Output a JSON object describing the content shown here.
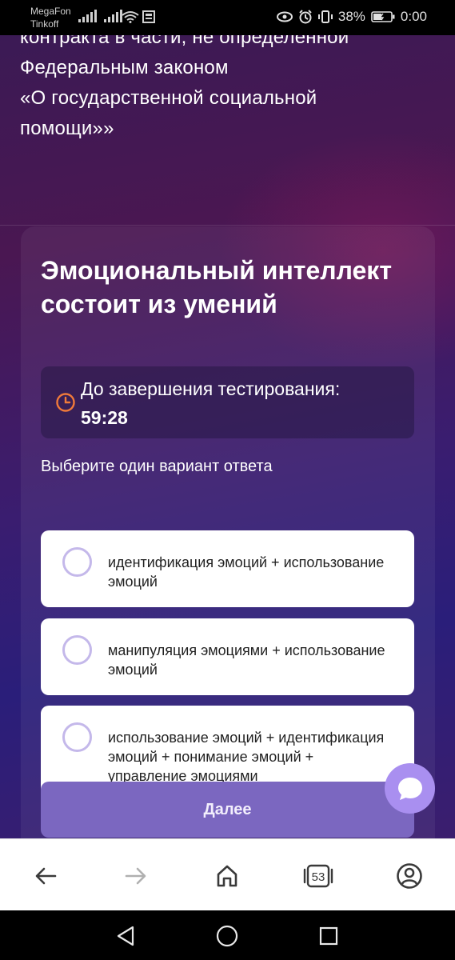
{
  "status_bar": {
    "carrier_1": "MegaFon",
    "carrier_2": "Tinkoff",
    "battery": "38%",
    "time": "0:00"
  },
  "page": {
    "top_text_lines": [
      "контракта в части, не определенной",
      "Федеральным законом",
      "«О государственной социальной",
      "помощи»»"
    ]
  },
  "question": {
    "title": "Эмоциональный интеллект состоит из умений",
    "timer_label": "До завершения тестирования:",
    "timer_value": "59:28",
    "instruction": "Выберите один вариант ответа",
    "options": [
      "идентификация эмоций + использование эмоций",
      "манипуляция эмоциями + использование эмоций",
      "использование эмоций + идентификация эмоций + понимание эмоций + управление эмоциями"
    ],
    "next_label": "Далее"
  },
  "browser_bar": {
    "tabs_count": "53"
  },
  "colors": {
    "accent": "#7b67c0",
    "radio_border": "#c4b8ea",
    "chat_fab": "#a98ff0",
    "timer_icon": "#f07a3a"
  }
}
